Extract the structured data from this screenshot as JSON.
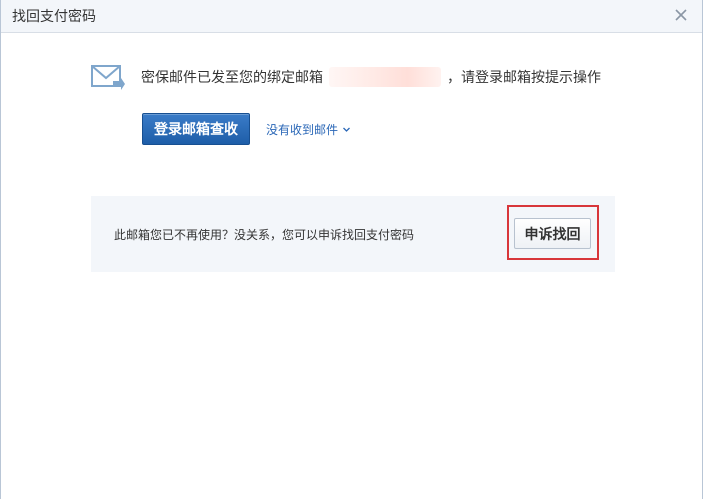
{
  "dialog": {
    "title": "找回支付密码"
  },
  "message": {
    "prefix": "密保邮件已发至您的绑定邮箱",
    "suffix": "，请登录邮箱按提示操作"
  },
  "actions": {
    "login_label": "登录邮箱查收",
    "no_mail_label": "没有收到邮件"
  },
  "appeal": {
    "text": "此邮箱您已不再使用？没关系，您可以申诉找回支付密码",
    "button_label": "申诉找回"
  },
  "colors": {
    "primary_button": "#1e5ea8",
    "link": "#2a67b7",
    "highlight": "#d8363a",
    "panel_bg": "#f3f6fa"
  },
  "icons": {
    "mail": "mail-send-icon",
    "close": "close-icon",
    "chevron": "chevron-down-icon"
  }
}
